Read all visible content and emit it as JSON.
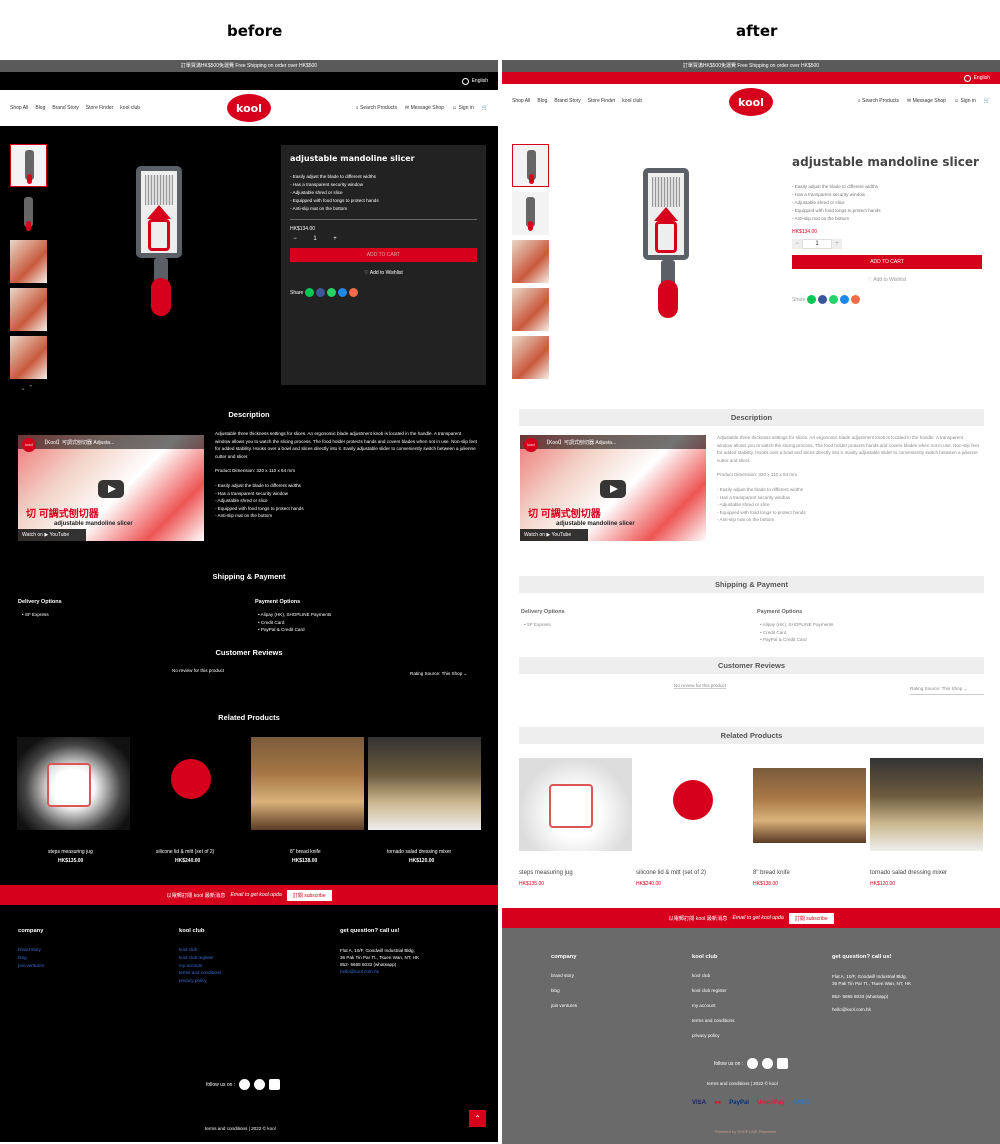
{
  "labels": {
    "before": "before",
    "after": "after"
  },
  "promo": "訂單買滿HK$500免運費 Free Shipping on order over HK$500",
  "lang": "English",
  "nav": {
    "left": [
      "Shop All",
      "Blog",
      "Brand Story",
      "Store Finder",
      "kool club"
    ],
    "logo": "kool",
    "right": [
      "Search Products",
      "Message Shop",
      "Sign in"
    ]
  },
  "product": {
    "title": "adjustable mandoline slicer",
    "bullets": [
      "- Easily adjust the blade to different widths",
      "- Has a transparent security window",
      "- Adjustable shred or slice",
      "- Equipped with food tongs to protect hands",
      "- Anti-slip mat on the bottom"
    ],
    "price": "HK$134.00",
    "qty": "1",
    "minus": "−",
    "plus": "+",
    "cart": "ADD TO CART",
    "wish": "♡ Add to Wishlist",
    "share": "Share",
    "arrows": "⌄  ⌃"
  },
  "description": {
    "title": "Description",
    "text": "Adjustable three thickness settings for slices. An ergonomic blade adjustment knob is located in the handle. A transparent window allows you to watch the slicing process. The food holder protects hands and covers blades when not in use. Non-slip feet for added stability. Hooks over a bowl and slices directly into it. Easily adjustable slider to conveniently switch between a julienne cutter and slicer.",
    "dimension": "Product Dimension: 320 x 110 x 64 mm",
    "bullets": [
      "- Easily adjust the blade to different widths",
      "- Has a transparent security window",
      "- Adjustable shred or slice",
      "- Equipped with food tongs to protect hands",
      "- Anti-slip mat on the bottom"
    ],
    "video_title": "【Kool】可調式刨切器 Adjusta...",
    "video_logo": "kool",
    "video_cap": "切   可調式刨切器",
    "video_cap2": "adjustable mandoline slicer",
    "video_watch": "Watch on ▶ YouTube"
  },
  "shipping": {
    "title": "Shipping & Payment",
    "delivery_h": "Delivery Options",
    "delivery": [
      "• SF Express"
    ],
    "payment_h": "Payment Options",
    "payment": [
      "• Alipay (HK), SHOPLINE Payments",
      "• Credit Card",
      "• PayPal & Credit Card"
    ]
  },
  "reviews": {
    "title": "Customer Reviews",
    "none": "No review for this product",
    "rating": "Rating Source: This Shop ⌄"
  },
  "related": {
    "title": "Related Products",
    "items": [
      {
        "name": "steps measuring jug",
        "price": "HK$135.00"
      },
      {
        "name": "silicone lid & mitt (set of 2)",
        "price": "HK$240.00"
      },
      {
        "name": "8\" bread knife",
        "price": "HK$138.00"
      },
      {
        "name": "tornado salad dressing mixer",
        "price": "HK$120.00"
      }
    ]
  },
  "subscribe": {
    "text": "以電郵訂閱 kool 最新消息",
    "input": "Email to get kool upda",
    "button": "訂閱 subscribe"
  },
  "footer": {
    "company_h": "company",
    "company": [
      "brand story",
      "blog",
      "join ventures"
    ],
    "club_h": "kool club",
    "club": [
      "kool club",
      "kool club register",
      "my account",
      "terms and conditions",
      "privacy policy"
    ],
    "contact_h": "get question? call us!",
    "addr1": "Flat A, 10/F, Goodwill Industrial Bldg,",
    "addr2": "36 Pak Tin Par Tt., Tsuen Wan, NT, HK",
    "phone": "852- 5665 6033 (whatsapp)",
    "email": "hello@kool.com.hk",
    "follow": "follow us on :",
    "terms": "terms and conditions | 2022 © kool",
    "pay": [
      "VISA",
      "●●",
      "PayPal",
      "UnionPay",
      "AMEX"
    ],
    "powered": "Powered by SHOPLINE Payments",
    "top": "⌃"
  },
  "colors": {
    "brand_red": "#d6001c",
    "footer_grey": "#6a6a6a"
  }
}
